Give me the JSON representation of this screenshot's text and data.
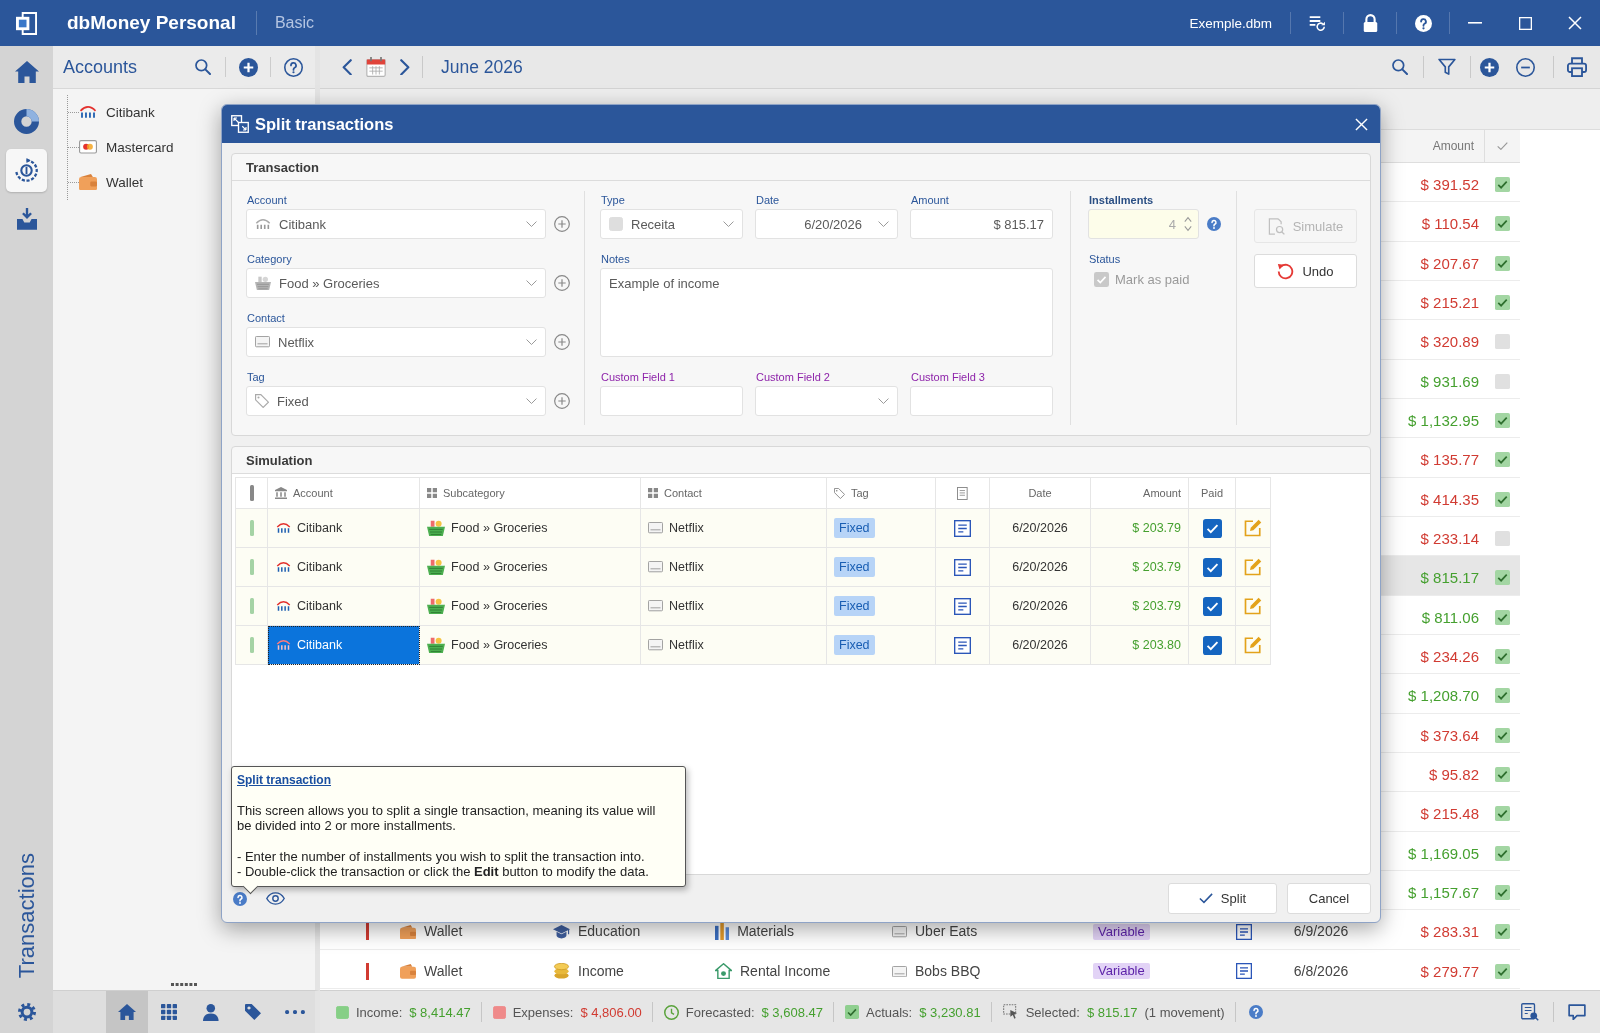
{
  "title_bar": {
    "app_name": "dbMoney Personal",
    "edition": "Basic",
    "file_name": "Exemple.dbm"
  },
  "nav_rail": {
    "items": [
      {
        "selected": false
      },
      {
        "selected": false
      },
      {
        "selected": true
      },
      {
        "selected": false
      }
    ],
    "section_title": "Transactions"
  },
  "accounts_panel": {
    "title": "Accounts",
    "accounts": [
      {
        "name": "Citibank",
        "kind": "bank"
      },
      {
        "name": "Mastercard",
        "kind": "card"
      },
      {
        "name": "Wallet",
        "kind": "cash"
      }
    ]
  },
  "bottom_nav": {
    "items": [
      {
        "selected": true
      },
      {
        "selected": false
      },
      {
        "selected": false
      },
      {
        "selected": false
      },
      {
        "selected": false
      }
    ]
  },
  "toolbar": {
    "period": "June 2026"
  },
  "transactions_table": {
    "amount_column": "Amount",
    "rows": [
      {
        "amount": "$ 391.52",
        "color": "#d13b32",
        "paid": true,
        "selected": false
      },
      {
        "amount": "$ 110.54",
        "color": "#d13b32",
        "paid": true,
        "selected": false
      },
      {
        "amount": "$ 207.67",
        "color": "#d13b32",
        "paid": true,
        "selected": false
      },
      {
        "amount": "$ 215.21",
        "color": "#d13b32",
        "paid": true,
        "selected": false
      },
      {
        "amount": "$ 320.89",
        "color": "#d13b32",
        "paid": false,
        "selected": false
      },
      {
        "amount": "$ 931.69",
        "color": "#45a02f",
        "paid": false,
        "selected": false
      },
      {
        "amount": "$ 1,132.95",
        "color": "#45a02f",
        "paid": true,
        "selected": false
      },
      {
        "amount": "$ 135.77",
        "color": "#d13b32",
        "paid": true,
        "selected": false
      },
      {
        "amount": "$ 414.35",
        "color": "#d13b32",
        "paid": true,
        "selected": false
      },
      {
        "amount": "$ 233.14",
        "color": "#d13b32",
        "paid": false,
        "selected": false
      },
      {
        "amount": "$ 815.17",
        "color": "#45a02f",
        "paid": true,
        "selected": true
      },
      {
        "amount": "$ 811.06",
        "color": "#45a02f",
        "paid": true,
        "selected": false
      },
      {
        "amount": "$ 234.26",
        "color": "#d13b32",
        "paid": true,
        "selected": false
      },
      {
        "amount": "$ 1,208.70",
        "color": "#45a02f",
        "paid": true,
        "selected": false
      },
      {
        "amount": "$ 373.64",
        "color": "#d13b32",
        "paid": true,
        "selected": false
      },
      {
        "amount": "$ 95.82",
        "color": "#d13b32",
        "paid": true,
        "selected": false
      },
      {
        "amount": "$ 215.48",
        "color": "#d13b32",
        "paid": true,
        "selected": false
      },
      {
        "amount": "$ 1,169.05",
        "color": "#45a02f",
        "paid": true,
        "selected": false
      },
      {
        "amount": "$ 1,157.67",
        "color": "#45a02f",
        "paid": true,
        "selected": false
      },
      {
        "account": {
          "name": "Wallet",
          "kind": "cash"
        },
        "category": "Education",
        "subcategory": "Materials",
        "contact": "Uber Eats",
        "tag": {
          "label": "Variable",
          "color": "#e2d3f6"
        },
        "date": "6/9/2026",
        "amount": "$ 283.31",
        "color": "#d13b32",
        "paid": true,
        "selected": false
      },
      {
        "account": {
          "name": "Wallet",
          "kind": "cash"
        },
        "category": "Income",
        "subcategory": "Rental Income",
        "contact": "Bobs BBQ",
        "tag": {
          "label": "Variable",
          "color": "#e2d3f6"
        },
        "date": "6/8/2026",
        "amount": "$ 279.77",
        "color": "#d13b32",
        "paid": true,
        "selected": false
      }
    ]
  },
  "split_dialog": {
    "title": "Split transactions",
    "transaction": {
      "heading": "Transaction",
      "account": {
        "label": "Account",
        "value": "Citibank",
        "kind": "bank"
      },
      "category": {
        "label": "Category",
        "value": "Food » Groceries"
      },
      "contact": {
        "label": "Contact",
        "value": "Netflix"
      },
      "tag": {
        "label": "Tag",
        "value": "Fixed"
      },
      "type": {
        "label": "Type",
        "value": "Receita"
      },
      "date": {
        "label": "Date",
        "value": "6/20/2026"
      },
      "amount": {
        "label": "Amount",
        "value": "$ 815.17"
      },
      "notes": {
        "label": "Notes",
        "value": "Example of income"
      },
      "custom_fields": [
        {
          "label": "Custom Field 1",
          "kind": "text"
        },
        {
          "label": "Custom Field 2",
          "kind": "dropdown"
        },
        {
          "label": "Custom Field 3",
          "kind": "text"
        }
      ],
      "installments": {
        "label": "Installments",
        "value": "4"
      },
      "status": {
        "label": "Status",
        "option": "Mark as paid",
        "checked": true,
        "disabled": true
      },
      "buttons": [
        {
          "label": "Simulate",
          "disabled": true
        },
        {
          "label": "Undo",
          "disabled": false
        }
      ]
    },
    "simulation": {
      "heading": "Simulation",
      "columns": [
        "Account",
        "Subcategory",
        "Contact",
        "Tag",
        "Date",
        "Amount",
        "Paid"
      ],
      "rows": [
        {
          "account": {
            "name": "Citibank",
            "kind": "bank"
          },
          "category": "Food » Groceries",
          "contact": "Netflix",
          "tag": {
            "label": "Fixed",
            "color": "#b7d4f7"
          },
          "date": "6/20/2026",
          "amount": "$ 203.79",
          "paid": true,
          "selected": false
        },
        {
          "account": {
            "name": "Citibank",
            "kind": "bank"
          },
          "category": "Food » Groceries",
          "contact": "Netflix",
          "tag": {
            "label": "Fixed",
            "color": "#b7d4f7"
          },
          "date": "6/20/2026",
          "amount": "$ 203.79",
          "paid": true,
          "selected": false
        },
        {
          "account": {
            "name": "Citibank",
            "kind": "bank"
          },
          "category": "Food » Groceries",
          "contact": "Netflix",
          "tag": {
            "label": "Fixed",
            "color": "#b7d4f7"
          },
          "date": "6/20/2026",
          "amount": "$ 203.79",
          "paid": true,
          "selected": false
        },
        {
          "account": {
            "name": "Citibank",
            "kind": "bank"
          },
          "category": "Food » Groceries",
          "contact": "Netflix",
          "tag": {
            "label": "Fixed",
            "color": "#b7d4f7"
          },
          "date": "6/20/2026",
          "amount": "$ 203.80",
          "paid": true,
          "selected": true
        }
      ]
    },
    "help_tip": {
      "title": "Split transaction",
      "intro": "This screen allows you to split a single transaction, meaning its value will be divided into 2 or more installments.",
      "steps": [
        "- Enter the number of installments you wish to split the transaction into.",
        "- Double-click the transaction or click the **Edit** button to modify the data."
      ]
    },
    "buttons": [
      {
        "label": "Split"
      },
      {
        "label": "Cancel"
      }
    ]
  },
  "status_bar": {
    "items": [
      {
        "label": "Income:",
        "value": "$ 8,414.47",
        "color": "#45a02f"
      },
      {
        "label": "Expenses:",
        "value": "$ 4,806.00",
        "color": "#d13b32"
      },
      {
        "label": "Forecasted:",
        "value": "$ 3,608.47",
        "color": "#45a02f"
      },
      {
        "label": "Actuals:",
        "value": "$ 3,230.81",
        "color": "#45a02f"
      },
      {
        "label": "Selected:",
        "value": "$ 815.17",
        "note": "(1 movement)",
        "color": "#45a02f"
      }
    ]
  }
}
